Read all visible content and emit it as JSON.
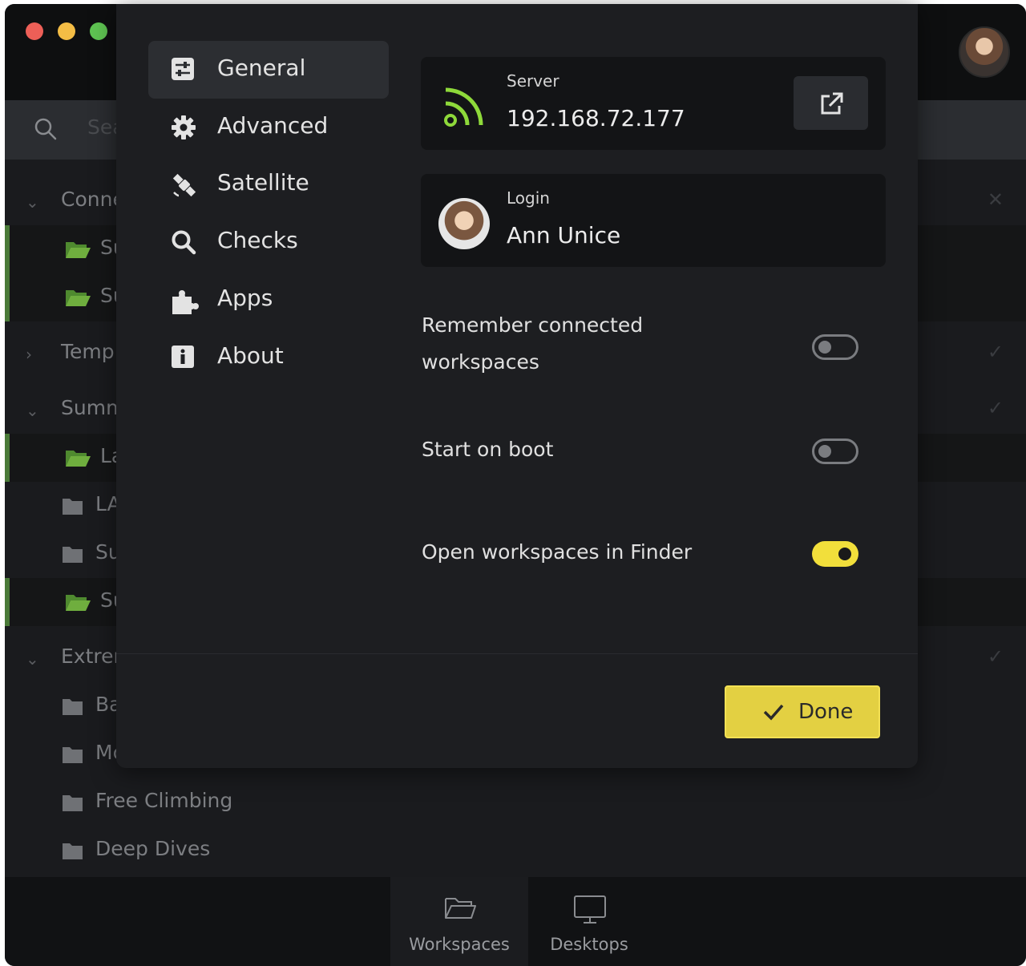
{
  "background_window": {
    "search": {
      "placeholder": "Sea"
    },
    "groups": [
      {
        "label": "Conne",
        "expanded": true
      },
      {
        "label": "Templ",
        "expanded": false
      },
      {
        "label": "Summ",
        "expanded": true
      },
      {
        "label": "Extren",
        "expanded": true
      }
    ],
    "items": {
      "conne_1": "Su",
      "conne_2": "Su",
      "summ_1": "La",
      "summ_2": "LA",
      "summ_3": "Su",
      "summ_4": "Su",
      "ext_1": "Ba",
      "ext_2": "Mc",
      "ext_3": "Free Climbing",
      "ext_4": "Deep Dives"
    },
    "bottom_tabs": [
      {
        "label": "Workspaces",
        "icon": "folder-open-icon",
        "active": true
      },
      {
        "label": "Desktops",
        "icon": "monitor-icon",
        "active": false
      }
    ]
  },
  "settings": {
    "nav": [
      {
        "label": "General",
        "icon": "sliders-icon",
        "selected": true
      },
      {
        "label": "Advanced",
        "icon": "gear-icon",
        "selected": false
      },
      {
        "label": "Satellite",
        "icon": "satellite-icon",
        "selected": false
      },
      {
        "label": "Checks",
        "icon": "search-icon",
        "selected": false
      },
      {
        "label": "Apps",
        "icon": "puzzle-icon",
        "selected": false
      },
      {
        "label": "About",
        "icon": "info-icon",
        "selected": false
      }
    ],
    "server": {
      "caption": "Server",
      "value": "192.168.72.177"
    },
    "login": {
      "caption": "Login",
      "value": "Ann Unice"
    },
    "options": {
      "remember_line1": "Remember connected",
      "remember_line2": "workspaces",
      "remember_on": false,
      "boot": "Start on boot",
      "boot_on": false,
      "finder": "Open workspaces in Finder",
      "finder_on": true
    },
    "done_label": "Done"
  },
  "colors": {
    "accent_yellow": "#e3d042",
    "wifi_green": "#8ed93a",
    "active_row_border": "#4a7a38"
  }
}
